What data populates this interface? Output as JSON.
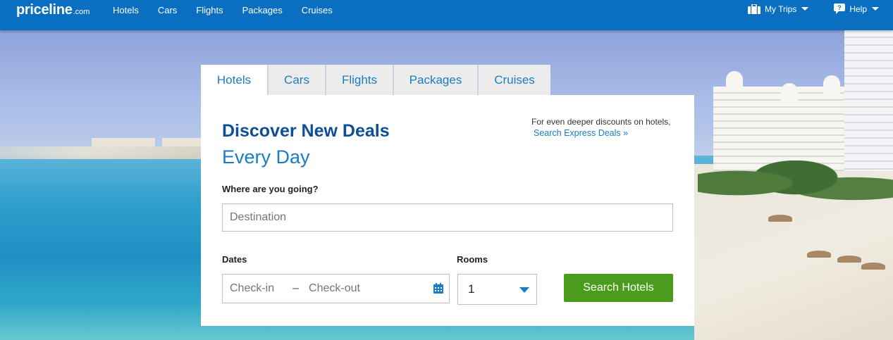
{
  "brand": {
    "logo_main": "priceline",
    "logo_domain": ".com"
  },
  "topnav": {
    "links": [
      "Hotels",
      "Cars",
      "Flights",
      "Packages",
      "Cruises"
    ],
    "my_trips": "My Trips",
    "help": "Help"
  },
  "search": {
    "tabs": [
      "Hotels",
      "Cars",
      "Flights",
      "Packages",
      "Cruises"
    ],
    "active_tab": "Hotels",
    "headline": "Discover New Deals",
    "subheadline": "Every Day",
    "express_note": "For even deeper discounts on hotels,",
    "express_link": "Search Express Deals »",
    "destination_label": "Where are you going?",
    "destination_placeholder": "Destination",
    "dates_label": "Dates",
    "checkin_placeholder": "Check-in",
    "date_separator": "–",
    "checkout_placeholder": "Check-out",
    "rooms_label": "Rooms",
    "rooms_value": "1",
    "submit_label": "Search Hotels"
  },
  "colors": {
    "nav_bg": "#0a6fc0",
    "brand_blue": "#1a7dc3",
    "headline_blue": "#0c4f96",
    "button_green": "#4b9b1c"
  }
}
